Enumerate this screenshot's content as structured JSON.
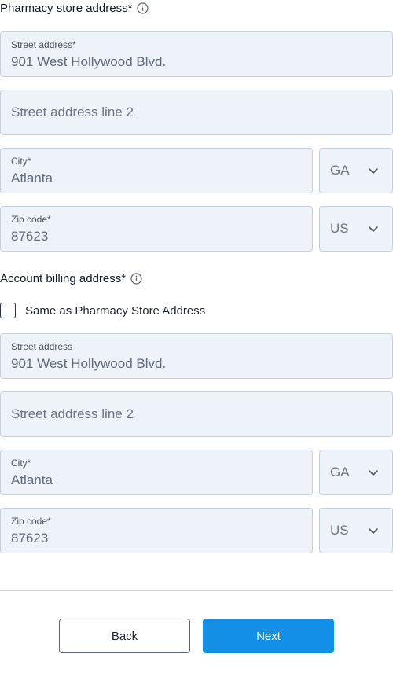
{
  "pharmacy": {
    "title": "Pharmacy store address*",
    "street": {
      "label": "Street address*",
      "value": "901 West Hollywood Blvd."
    },
    "street2": {
      "placeholder": "Street address line 2"
    },
    "city": {
      "label": "City*",
      "value": "Atlanta"
    },
    "state": {
      "value": "GA"
    },
    "zip": {
      "label": "Zip code*",
      "value": "87623"
    },
    "country": {
      "value": "US"
    }
  },
  "billing": {
    "title": "Account billing address*",
    "same_as_checkbox": {
      "label": "Same as Pharmacy Store Address",
      "checked": false
    },
    "street": {
      "label": "Street address",
      "value": "901 West Hollywood Blvd."
    },
    "street2": {
      "placeholder": "Street address line 2"
    },
    "city": {
      "label": "City*",
      "value": "Atlanta"
    },
    "state": {
      "value": "GA"
    },
    "zip": {
      "label": "Zip code*",
      "value": "87623"
    },
    "country": {
      "value": "US"
    }
  },
  "buttons": {
    "back": "Back",
    "next": "Next"
  },
  "icons": {
    "info": "info-icon",
    "chevron": "chevron-down-icon"
  },
  "colors": {
    "field_bg": "#eef3fa",
    "field_border": "#c7cfda",
    "primary": "#1390e5"
  }
}
